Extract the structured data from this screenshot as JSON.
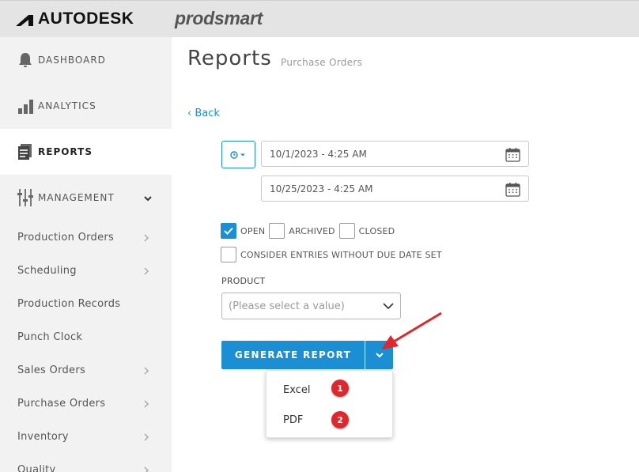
{
  "header": {
    "brand": "AUTODESK",
    "product": "prodsmart"
  },
  "sidebar": {
    "main_items": [
      {
        "label": "DASHBOARD",
        "icon": "bell-icon"
      },
      {
        "label": "ANALYTICS",
        "icon": "bar-chart-icon"
      },
      {
        "label": "REPORTS",
        "icon": "report-icon",
        "active": true
      },
      {
        "label": "MANAGEMENT",
        "icon": "sliders-icon",
        "expanded": true
      }
    ],
    "sub_items": [
      {
        "label": "Production Orders",
        "has_chevron": true
      },
      {
        "label": "Scheduling",
        "has_chevron": true
      },
      {
        "label": "Production Records",
        "has_chevron": false
      },
      {
        "label": "Punch Clock",
        "has_chevron": false
      },
      {
        "label": "Sales Orders",
        "has_chevron": true
      },
      {
        "label": "Purchase Orders",
        "has_chevron": true
      },
      {
        "label": "Inventory",
        "has_chevron": true
      },
      {
        "label": "Quality",
        "has_chevron": true
      }
    ]
  },
  "main": {
    "title": "Reports",
    "subtitle": "Purchase Orders",
    "back_label": "‹ Back",
    "date_from": "10/1/2023 - 4:25 AM",
    "date_to": "10/25/2023 - 4:25 AM",
    "filters": {
      "open": {
        "label": "OPEN",
        "checked": true
      },
      "archived": {
        "label": "ARCHIVED",
        "checked": false
      },
      "closed": {
        "label": "CLOSED",
        "checked": false
      },
      "no_due_date": {
        "label": "CONSIDER ENTRIES WITHOUT DUE DATE SET",
        "checked": false
      }
    },
    "product_label": "PRODUCT",
    "product_placeholder": "(Please select a value)",
    "generate_label": "GENERATE REPORT",
    "export_options": [
      "Excel",
      "PDF"
    ],
    "badges": [
      "1",
      "2"
    ]
  },
  "colors": {
    "accent": "#1b8fd4",
    "badge": "#e3262b",
    "sidebar_bg": "#f2f2f2",
    "topbar_bg": "#e4e4e4"
  }
}
